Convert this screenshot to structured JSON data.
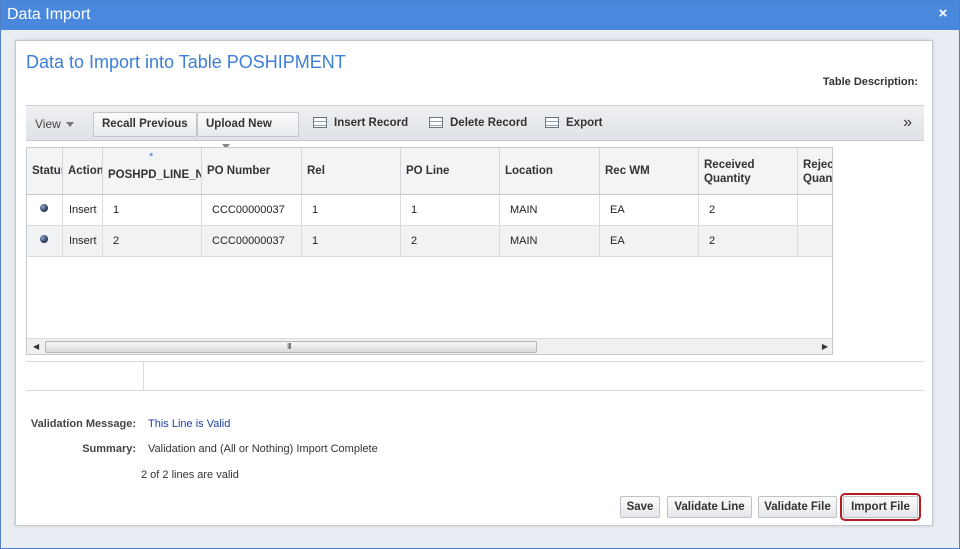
{
  "window": {
    "title": "Data Import",
    "close_glyph": "×"
  },
  "page": {
    "heading": "Data to Import into Table POSHIPMENT",
    "table_description_label": "Table Description:"
  },
  "toolbar": {
    "view_label": "View",
    "recall_label": "Recall Previous",
    "upload_label": "Upload New",
    "insert_label": "Insert Record",
    "delete_label": "Delete Record",
    "export_label": "Export",
    "more_glyph": "»"
  },
  "grid": {
    "columns": [
      {
        "label": "Status"
      },
      {
        "label": "Action"
      },
      {
        "label": "POSHPD_LINE_NUM",
        "required_mark": "*"
      },
      {
        "label": "PO Number"
      },
      {
        "label": "Rel"
      },
      {
        "label": "PO Line"
      },
      {
        "label": "Location"
      },
      {
        "label": "Rec WM"
      },
      {
        "label": "Received Quantity"
      },
      {
        "label": "Rejected Quantity"
      }
    ],
    "rows": [
      {
        "action": "Insert",
        "line_num": "1",
        "po_number": "CCC00000037",
        "rel": "1",
        "po_line": "1",
        "location": "MAIN",
        "rec_wm": "EA",
        "received_qty": "2",
        "rejected_qty": ""
      },
      {
        "action": "Insert",
        "line_num": "2",
        "po_number": "CCC00000037",
        "rel": "1",
        "po_line": "2",
        "location": "MAIN",
        "rec_wm": "EA",
        "received_qty": "2",
        "rejected_qty": ""
      }
    ],
    "scrollbar": {
      "left_glyph": "◀",
      "right_glyph": "▶",
      "grip_glyph": "III"
    }
  },
  "validation": {
    "message_label": "Validation Message:",
    "message_value": "This Line is Valid",
    "summary_label": "Summary:",
    "summary_value": "Validation and (All or Nothing) Import Complete",
    "lines_valid": "2 of 2 lines are valid"
  },
  "actions": {
    "save_label": "Save",
    "validate_line_label": "Validate Line",
    "validate_file_label": "Validate File",
    "import_file_label": "Import File"
  },
  "colors": {
    "titlebar": "#4a88de",
    "heading": "#3b7fd6",
    "highlight": "#b01e24",
    "valid_text": "#1f3fa8"
  }
}
